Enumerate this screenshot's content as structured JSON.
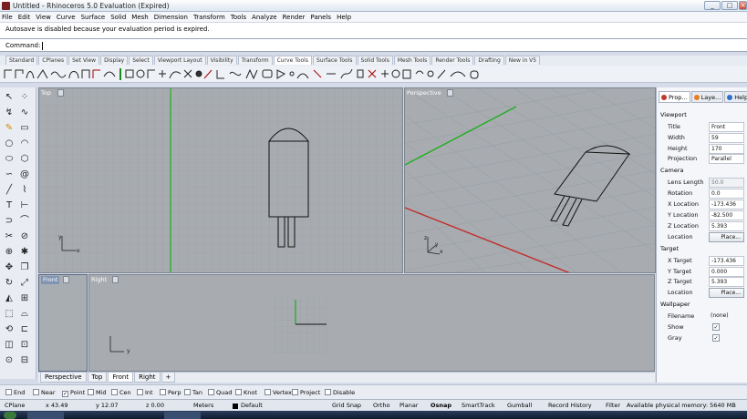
{
  "window": {
    "title": "Untitled - Rhinoceros 5.0 Evaluation (Expired)",
    "min": "_",
    "max": "□",
    "close": "×"
  },
  "menu": [
    "File",
    "Edit",
    "View",
    "Curve",
    "Surface",
    "Solid",
    "Mesh",
    "Dimension",
    "Transform",
    "Tools",
    "Analyze",
    "Render",
    "Panels",
    "Help"
  ],
  "history": {
    "line": "Autosave is disabled because your evaluation period is expired."
  },
  "command": {
    "label": "Command:",
    "value": ""
  },
  "toolbar_tabs": [
    "Standard",
    "CPlanes",
    "Set View",
    "Display",
    "Select",
    "Viewport Layout",
    "Visibility",
    "Transform",
    "Curve Tools",
    "Surface Tools",
    "Solid Tools",
    "Mesh Tools",
    "Render Tools",
    "Drafting",
    "New in V5"
  ],
  "active_toolbar_tab": "Curve Tools",
  "viewports": {
    "top": {
      "label": "Top"
    },
    "perspective": {
      "label": "Perspective"
    },
    "front": {
      "label": "Front"
    },
    "right": {
      "label": "Right"
    }
  },
  "axes": {
    "x": "x",
    "y": "y",
    "z": "z"
  },
  "viewport_tabs": [
    "Perspective",
    "Top",
    "Front",
    "Right"
  ],
  "active_viewport_tab": "Front",
  "add_viewport_tab": "+",
  "panel": {
    "tabs": [
      "Prop...",
      "Laye...",
      "Help"
    ],
    "viewport_section": "Viewport",
    "title": {
      "label": "Title",
      "value": "Front"
    },
    "width": {
      "label": "Width",
      "value": "59"
    },
    "height": {
      "label": "Height",
      "value": "170"
    },
    "projection": {
      "label": "Projection",
      "value": "Parallel"
    },
    "camera_section": "Camera",
    "lens_length": {
      "label": "Lens Length",
      "value": "50.0"
    },
    "rotation": {
      "label": "Rotation",
      "value": "0.0"
    },
    "x_location": {
      "label": "X Location",
      "value": "-173.436"
    },
    "y_location": {
      "label": "Y Location",
      "value": "-82.500"
    },
    "z_location": {
      "label": "Z Location",
      "value": "5.393"
    },
    "location": {
      "label": "Location",
      "button": "Place..."
    },
    "target_section": "Target",
    "x_target": {
      "label": "X Target",
      "value": "-173.436"
    },
    "y_target": {
      "label": "Y Target",
      "value": "0.000"
    },
    "z_target": {
      "label": "Z Target",
      "value": "5.393"
    },
    "target_location": {
      "label": "Location",
      "button": "Place..."
    },
    "wallpaper_section": "Wallpaper",
    "filename": {
      "label": "Filename",
      "value": "(none)"
    },
    "show": {
      "label": "Show",
      "checked": "✓"
    },
    "gray": {
      "label": "Gray",
      "checked": "✓"
    }
  },
  "osnaps": [
    {
      "label": "End",
      "checked": ""
    },
    {
      "label": "Near",
      "checked": ""
    },
    {
      "label": "Point",
      "checked": "✓"
    },
    {
      "label": "Mid",
      "checked": ""
    },
    {
      "label": "Cen",
      "checked": ""
    },
    {
      "label": "Int",
      "checked": ""
    },
    {
      "label": "Perp",
      "checked": ""
    },
    {
      "label": "Tan",
      "checked": ""
    },
    {
      "label": "Quad",
      "checked": ""
    },
    {
      "label": "Knot",
      "checked": ""
    },
    {
      "label": "Vertex",
      "checked": ""
    },
    {
      "label": "Project",
      "checked": ""
    },
    {
      "label": "Disable",
      "checked": ""
    }
  ],
  "status": {
    "cplane": "CPlane",
    "x": "x 43.49",
    "y": "y 12.07",
    "z": "z 0.00",
    "units": "Meters",
    "layer": "Default",
    "grid_snap": "Grid Snap",
    "ortho": "Ortho",
    "planar": "Planar",
    "osnap": "Osnap",
    "smarttrack": "SmartTrack",
    "gumball": "Gumball",
    "record_history": "Record History",
    "filter": "Filter",
    "memory": "Available physical memory: 5640 MB"
  },
  "colors": {
    "x_axis": "#c22b2b",
    "y_axis": "#28a028",
    "grid": "#9aa0a6",
    "viewport_bg": "#a8acb0"
  }
}
